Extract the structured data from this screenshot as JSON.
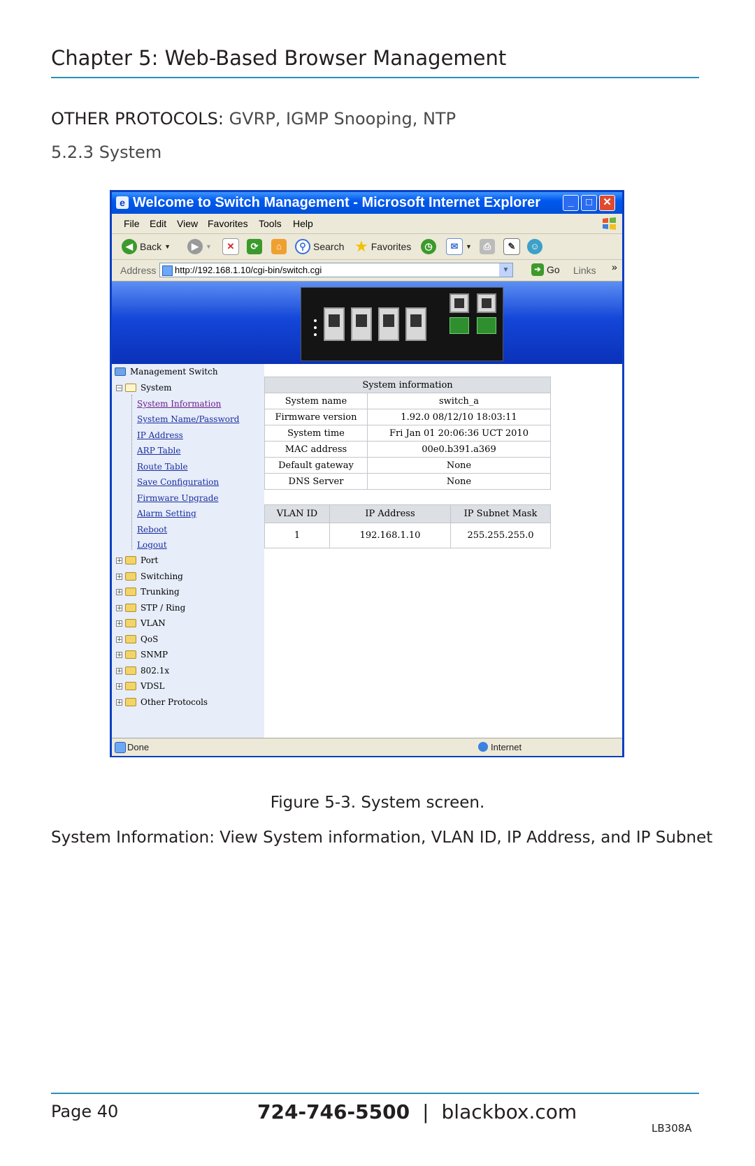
{
  "chapter_title": "Chapter 5: Web-Based Browser Management",
  "section": {
    "strong": "OTHER PROTOCOLS:",
    "light": " GVRP, IGMP Snooping, NTP"
  },
  "subsection": "5.2.3 System",
  "browser": {
    "title": "Welcome to Switch Management - Microsoft Internet Explorer",
    "menu": [
      "File",
      "Edit",
      "View",
      "Favorites",
      "Tools",
      "Help"
    ],
    "toolbar": {
      "back": "Back",
      "search": "Search",
      "favorites": "Favorites"
    },
    "address_label": "Address",
    "address": "http://192.168.1.10/cgi-bin/switch.cgi",
    "go": "Go",
    "links": "Links",
    "status_left": "Done",
    "status_right": "Internet"
  },
  "tree": {
    "root": "Management Switch",
    "system": "System",
    "system_links": [
      "System Information",
      "System Name/Password",
      "IP Address",
      "ARP Table",
      "Route Table",
      "Save Configuration",
      "Firmware Upgrade",
      "Alarm Setting",
      "Reboot",
      "Logout"
    ],
    "folders": [
      "Port",
      "Switching",
      "Trunking",
      "STP / Ring",
      "VLAN",
      "QoS",
      "SNMP",
      "802.1x",
      "VDSL",
      "Other Protocols"
    ]
  },
  "system_info": {
    "title": "System information",
    "rows": [
      {
        "label": "System name",
        "value": "switch_a"
      },
      {
        "label": "Firmware version",
        "value": "1.92.0 08/12/10 18:03:11"
      },
      {
        "label": "System time",
        "value": "Fri Jan 01 20:06:36 UCT 2010"
      },
      {
        "label": "MAC address",
        "value": "00e0.b391.a369"
      },
      {
        "label": "Default gateway",
        "value": "None"
      },
      {
        "label": "DNS Server",
        "value": "None"
      }
    ]
  },
  "vlan_table": {
    "headers": [
      "VLAN ID",
      "IP Address",
      "IP Subnet Mask"
    ],
    "row": [
      "1",
      "192.168.1.10",
      "255.255.255.0"
    ]
  },
  "caption": "Figure 5-3. System screen.",
  "description": "System Information: View System information, VLAN ID, IP Address, and IP Subnet",
  "footer": {
    "page": "Page 40",
    "phone": "724-746-5500",
    "separator": "|",
    "site": "blackbox.com",
    "code": "LB308A"
  },
  "colors": {
    "rule": "#2a8fb7",
    "titlebar": "#0058ee",
    "banner": "#1446d8"
  }
}
